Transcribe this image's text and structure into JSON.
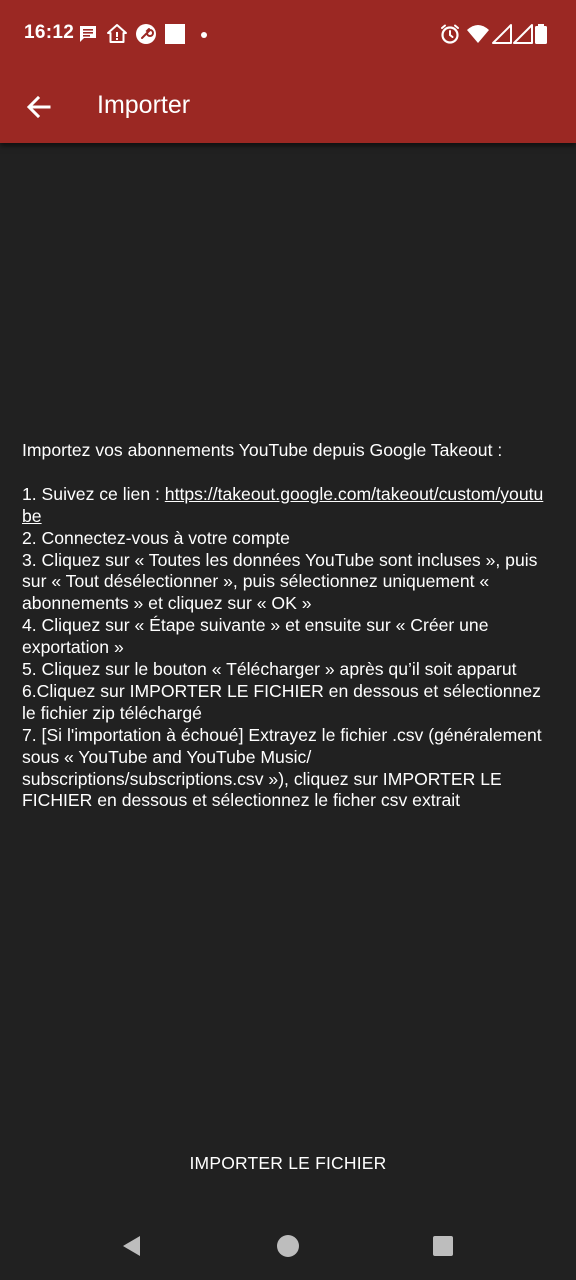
{
  "status_bar": {
    "time": "16:12",
    "left_icons": [
      "message-icon",
      "home-alert-icon",
      "wrench-badge-icon",
      "white-square-icon",
      "dot-icon"
    ],
    "right_icons": [
      "alarm-icon",
      "wifi-icon",
      "signal-icon",
      "signal-icon-2",
      "battery-icon"
    ]
  },
  "toolbar": {
    "title": "Importer",
    "background": "#9b2823"
  },
  "content": {
    "intro": "Importez vos abonnements YouTube depuis Google Takeout :",
    "step1_prefix": "1. Suivez ce lien : ",
    "step1_link": "https://takeout.google.com/takeout/custom/youtube",
    "step2": "2. Connectez-vous à votre compte",
    "step3": "3. Cliquez sur « Toutes les données YouTube sont incluses », puis sur « Tout désélectionner », puis sélectionnez uniquement « abonnements » et cliquez sur « OK »",
    "step4": "4. Cliquez sur « Étape suivante » et ensuite sur « Créer une exportation »",
    "step5": "5. Cliquez sur le bouton « Télécharger » après qu’il soit apparut",
    "step6": "6.Cliquez sur IMPORTER LE FICHIER en dessous et sélectionnez le fichier zip téléchargé",
    "step7": "7. [Si l'importation à échoué] Extrayez le fichier .csv (généralement sous « YouTube and YouTube Music/ subscriptions/subscriptions.csv »), cliquez sur IMPORTER LE FICHIER en dessous et sélectionnez le ficher csv extrait"
  },
  "actions": {
    "import_label": "IMPORTER LE FICHIER"
  },
  "nav": {
    "icons": [
      "back-triangle-icon",
      "home-circle-icon",
      "recents-square-icon"
    ]
  },
  "colors": {
    "background": "#212121",
    "appbar": "#9b2823",
    "text": "#ffffff"
  }
}
